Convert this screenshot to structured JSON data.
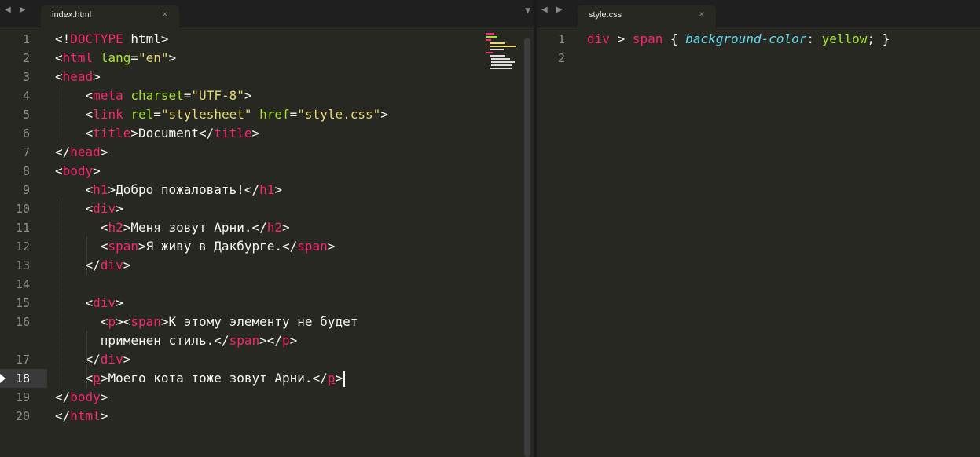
{
  "window": {
    "tabs": [
      {
        "label": "index.html",
        "close_icon": "×"
      },
      {
        "label": "style.css",
        "close_icon": "×"
      }
    ],
    "nav_arrows": "◀ ▶",
    "tab_dropdown": "▼"
  },
  "left_editor": {
    "line_numbers": [
      "1",
      "2",
      "3",
      "4",
      "5",
      "6",
      "7",
      "8",
      "9",
      "10",
      "11",
      "12",
      "13",
      "14",
      "15",
      "16",
      "17",
      "18",
      "19",
      "20"
    ],
    "current_line": "18",
    "lines": [
      [
        {
          "t": "<!",
          "c": "p"
        },
        {
          "t": "DOCTYPE",
          "c": "t"
        },
        {
          "t": " html>",
          "c": "p"
        }
      ],
      [
        {
          "t": "<",
          "c": "p"
        },
        {
          "t": "html",
          "c": "t"
        },
        {
          "t": " ",
          "c": "p"
        },
        {
          "t": "lang",
          "c": "a"
        },
        {
          "t": "=",
          "c": "p"
        },
        {
          "t": "\"en\"",
          "c": "s"
        },
        {
          "t": ">",
          "c": "p"
        }
      ],
      [
        {
          "t": "<",
          "c": "p"
        },
        {
          "t": "head",
          "c": "t"
        },
        {
          "t": ">",
          "c": "p"
        }
      ],
      [
        {
          "t": "    <",
          "c": "p"
        },
        {
          "t": "meta",
          "c": "t"
        },
        {
          "t": " ",
          "c": "p"
        },
        {
          "t": "charset",
          "c": "a"
        },
        {
          "t": "=",
          "c": "p"
        },
        {
          "t": "\"UTF-8\"",
          "c": "s"
        },
        {
          "t": ">",
          "c": "p"
        }
      ],
      [
        {
          "t": "    <",
          "c": "p"
        },
        {
          "t": "link",
          "c": "t"
        },
        {
          "t": " ",
          "c": "p"
        },
        {
          "t": "rel",
          "c": "a"
        },
        {
          "t": "=",
          "c": "p"
        },
        {
          "t": "\"stylesheet\"",
          "c": "s"
        },
        {
          "t": " ",
          "c": "p"
        },
        {
          "t": "href",
          "c": "a"
        },
        {
          "t": "=",
          "c": "p"
        },
        {
          "t": "\"style.css\"",
          "c": "s"
        },
        {
          "t": ">",
          "c": "p"
        }
      ],
      [
        {
          "t": "    <",
          "c": "p"
        },
        {
          "t": "title",
          "c": "t"
        },
        {
          "t": ">Document</",
          "c": "p"
        },
        {
          "t": "title",
          "c": "t"
        },
        {
          "t": ">",
          "c": "p"
        }
      ],
      [
        {
          "t": "</",
          "c": "p"
        },
        {
          "t": "head",
          "c": "t"
        },
        {
          "t": ">",
          "c": "p"
        }
      ],
      [
        {
          "t": "<",
          "c": "p"
        },
        {
          "t": "body",
          "c": "t"
        },
        {
          "t": ">",
          "c": "p"
        }
      ],
      [
        {
          "t": "    <",
          "c": "p"
        },
        {
          "t": "h1",
          "c": "t"
        },
        {
          "t": ">Добро пожаловать!</",
          "c": "p"
        },
        {
          "t": "h1",
          "c": "t"
        },
        {
          "t": ">",
          "c": "p"
        }
      ],
      [
        {
          "t": "    <",
          "c": "p"
        },
        {
          "t": "div",
          "c": "t"
        },
        {
          "t": ">",
          "c": "p"
        }
      ],
      [
        {
          "t": "      <",
          "c": "p"
        },
        {
          "t": "h2",
          "c": "t"
        },
        {
          "t": ">Меня зовут Арни.</",
          "c": "p"
        },
        {
          "t": "h2",
          "c": "t"
        },
        {
          "t": ">",
          "c": "p"
        }
      ],
      [
        {
          "t": "      <",
          "c": "p"
        },
        {
          "t": "span",
          "c": "t"
        },
        {
          "t": ">Я живу в Дакбурге.</",
          "c": "p"
        },
        {
          "t": "span",
          "c": "t"
        },
        {
          "t": ">",
          "c": "p"
        }
      ],
      [
        {
          "t": "    </",
          "c": "p"
        },
        {
          "t": "div",
          "c": "t"
        },
        {
          "t": ">",
          "c": "p"
        }
      ],
      [],
      [
        {
          "t": "    <",
          "c": "p"
        },
        {
          "t": "div",
          "c": "t"
        },
        {
          "t": ">",
          "c": "p"
        }
      ],
      [
        {
          "t": "      <",
          "c": "p"
        },
        {
          "t": "p",
          "c": "t"
        },
        {
          "t": "><",
          "c": "p"
        },
        {
          "t": "span",
          "c": "t"
        },
        {
          "t": ">К этому элементу не будет",
          "c": "p"
        }
      ],
      [
        {
          "t": "      применен стиль.</",
          "c": "p"
        },
        {
          "t": "span",
          "c": "t"
        },
        {
          "t": "></",
          "c": "p"
        },
        {
          "t": "p",
          "c": "t"
        },
        {
          "t": ">",
          "c": "p"
        }
      ],
      [
        {
          "t": "    </",
          "c": "p"
        },
        {
          "t": "div",
          "c": "t"
        },
        {
          "t": ">",
          "c": "p"
        }
      ],
      [
        {
          "t": "    <",
          "c": "p"
        },
        {
          "t": "p",
          "c": "t u"
        },
        {
          "t": ">Моего кота тоже зовут Арни.</",
          "c": "p"
        },
        {
          "t": "p",
          "c": "t u"
        },
        {
          "t": ">",
          "c": "p"
        }
      ],
      [
        {
          "t": "</",
          "c": "p"
        },
        {
          "t": "body",
          "c": "t"
        },
        {
          "t": ">",
          "c": "p"
        }
      ],
      [
        {
          "t": "</",
          "c": "p"
        },
        {
          "t": "html",
          "c": "t"
        },
        {
          "t": ">",
          "c": "p"
        }
      ]
    ],
    "gutter_labels": [
      "1",
      "2",
      "3",
      "4",
      "5",
      "6",
      "7",
      "8",
      "9",
      "10",
      "11",
      "12",
      "13",
      "14",
      "15",
      "16",
      "",
      "17",
      "18",
      "19",
      "20"
    ]
  },
  "right_editor": {
    "line_numbers": [
      "1",
      "2"
    ],
    "lines": [
      [
        {
          "t": "div",
          "c": "t"
        },
        {
          "t": " > ",
          "c": "p"
        },
        {
          "t": "span",
          "c": "t"
        },
        {
          "t": " { ",
          "c": "p"
        },
        {
          "t": "background-color",
          "c": "k"
        },
        {
          "t": ": ",
          "c": "p"
        },
        {
          "t": "yellow",
          "c": "a"
        },
        {
          "t": "; }",
          "c": "p"
        }
      ],
      []
    ]
  },
  "colors": {
    "background": "#272822",
    "tag": "#f92672",
    "attribute": "#a6e22e",
    "string": "#e6db74",
    "text": "#f8f8f2",
    "property": "#66d9ef"
  }
}
